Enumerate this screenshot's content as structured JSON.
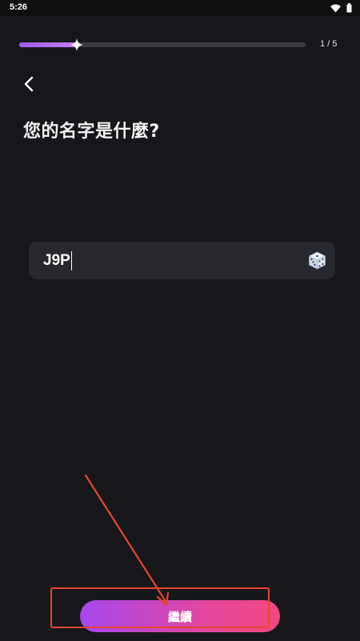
{
  "status_bar": {
    "time": "5:26",
    "icons": [
      "wifi-icon",
      "battery-icon"
    ]
  },
  "progress": {
    "fraction": 0.2,
    "count_label": "1 / 5"
  },
  "header": {
    "back_icon": "chevron-left-icon"
  },
  "page": {
    "title": "您的名字是什麼?"
  },
  "name_field": {
    "value": "J9P",
    "randomize_icon": "dice-icon"
  },
  "footer": {
    "continue_label": "繼續"
  },
  "annotations": {
    "color": "#e8452f"
  },
  "colors": {
    "background": "#16171a",
    "field_background": "#27282d",
    "progress_fill": "#b06ef5",
    "button_gradient_start": "#a547ee",
    "button_gradient_end": "#f2487f"
  }
}
